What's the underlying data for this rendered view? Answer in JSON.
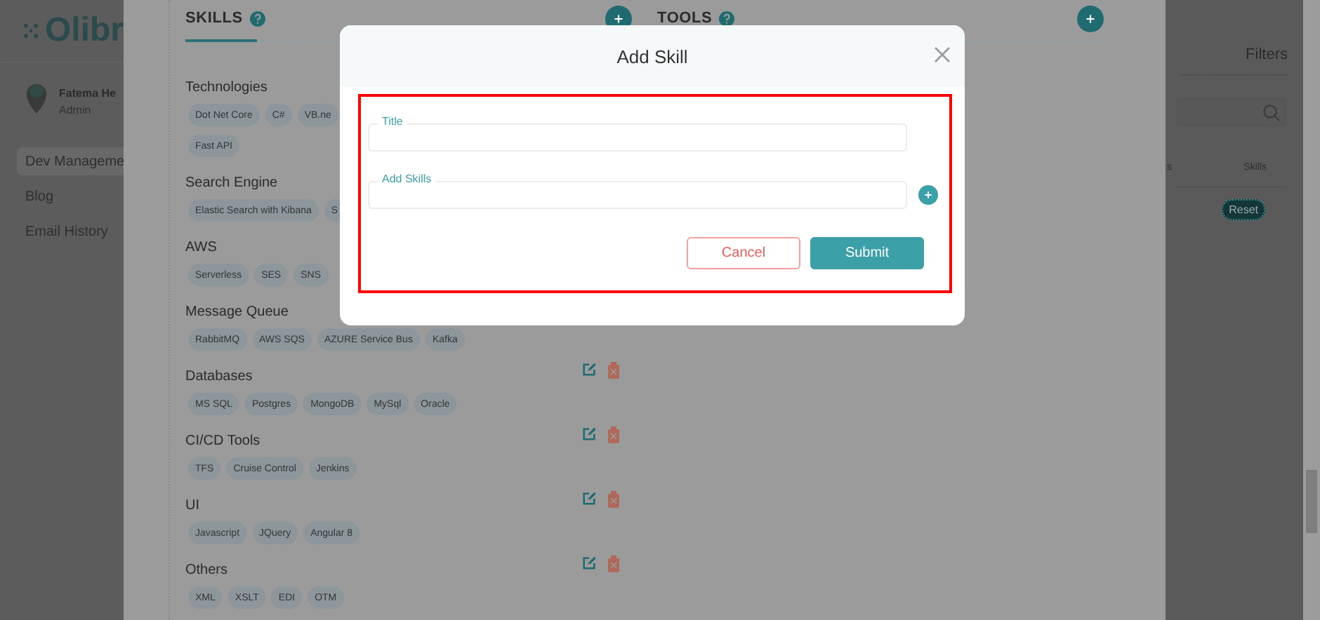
{
  "sidebar": {
    "logo": "Olibr",
    "user": {
      "name": "Fatema He",
      "role": "Admin"
    },
    "items": [
      {
        "label": "Dev Manageme",
        "selected": true
      },
      {
        "label": "Blog",
        "selected": false
      },
      {
        "label": "Email History",
        "selected": false
      }
    ]
  },
  "drawer": {
    "sections": [
      {
        "title": "SKILLS",
        "categories": [
          {
            "name": "Technologies",
            "actions": false,
            "chips": [
              "Dot Net Core",
              "C#",
              "VB.ne",
              "Fast API"
            ]
          },
          {
            "name": "Search Engine",
            "actions": false,
            "chips": [
              "Elastic Search with Kibana",
              "S"
            ]
          },
          {
            "name": "AWS",
            "actions": false,
            "chips": [
              "Serverless",
              "SES",
              "SNS"
            ]
          },
          {
            "name": "Message Queue",
            "actions": false,
            "chips": [
              "RabbitMQ",
              "AWS SQS",
              "AZURE Service Bus",
              "Kafka"
            ]
          },
          {
            "name": "Databases",
            "actions": true,
            "chips": [
              "MS SQL",
              "Postgres",
              "MongoDB",
              "MySql",
              "Oracle"
            ]
          },
          {
            "name": "CI/CD Tools",
            "actions": true,
            "chips": [
              "TFS",
              "Cruise Control",
              "Jenkins"
            ]
          },
          {
            "name": "UI",
            "actions": true,
            "chips": [
              "Javascript",
              "JQuery",
              "Angular 8"
            ]
          },
          {
            "name": "Others",
            "actions": true,
            "chips": [
              "XML",
              "XSLT",
              "EDI",
              "OTM"
            ]
          }
        ]
      },
      {
        "title": "TOOLS"
      }
    ]
  },
  "filters_panel": {
    "title": "Filters",
    "columns": [
      "s",
      "Skills"
    ],
    "reset": "Reset"
  },
  "modal": {
    "title": "Add Skill",
    "highlighted": true,
    "fields": [
      {
        "label": "Title",
        "has_add": false
      },
      {
        "label": "Add Skills",
        "has_add": true
      }
    ],
    "buttons": [
      {
        "label": "Cancel",
        "kind": "secondary"
      },
      {
        "label": "Submit",
        "kind": "primary"
      }
    ]
  }
}
